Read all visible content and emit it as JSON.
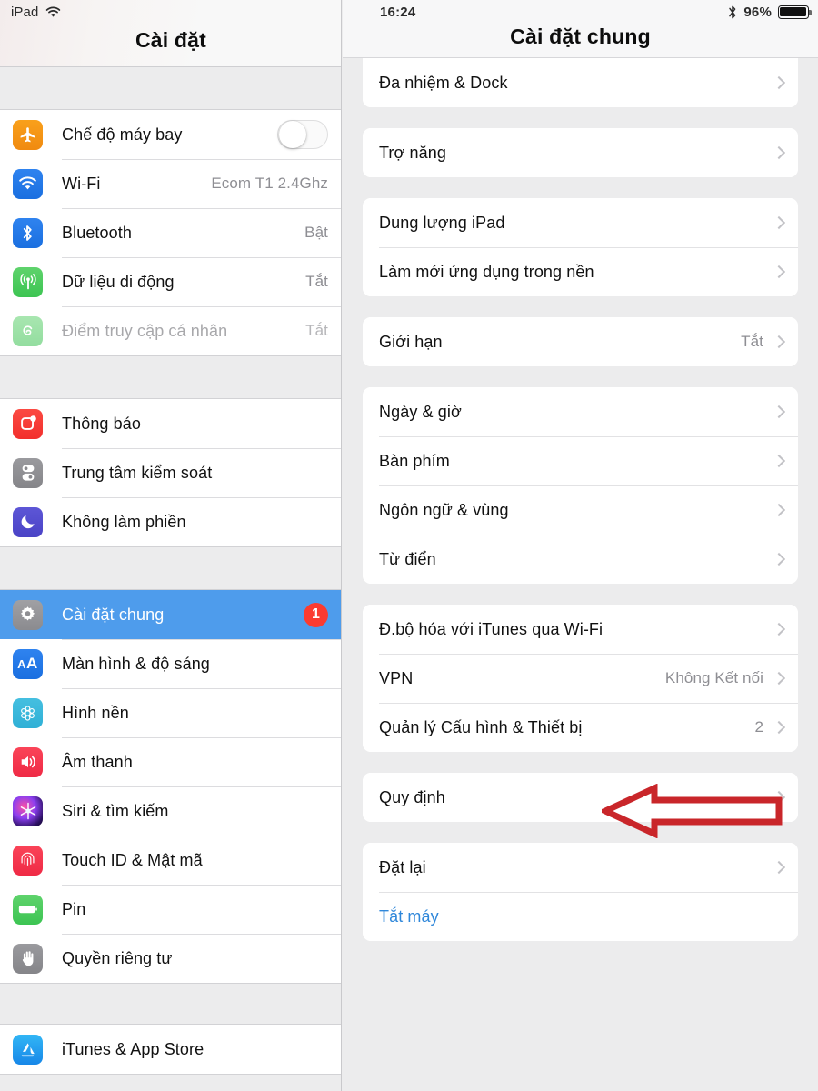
{
  "status_bar": {
    "device_label": "iPad",
    "wifi_icon": "wifi-icon",
    "time": "16:24",
    "bluetooth_icon": "bluetooth-icon",
    "battery_percent": "96%",
    "battery_level": 96
  },
  "sidebar": {
    "title": "Cài đặt",
    "groups": [
      {
        "rows": [
          {
            "icon": "airplane-icon",
            "label": "Chế độ máy bay",
            "control": "toggle",
            "toggle_on": false
          },
          {
            "icon": "wifi-icon",
            "label": "Wi-Fi",
            "value": "Ecom T1 2.4Ghz"
          },
          {
            "icon": "bluetooth-icon",
            "label": "Bluetooth",
            "value": "Bật"
          },
          {
            "icon": "cellular-icon",
            "label": "Dữ liệu di động",
            "value": "Tắt"
          },
          {
            "icon": "hotspot-icon",
            "label": "Điểm truy cập cá nhân",
            "value": "Tắt",
            "disabled": true
          }
        ]
      },
      {
        "rows": [
          {
            "icon": "notifications-icon",
            "label": "Thông báo"
          },
          {
            "icon": "control-center-icon",
            "label": "Trung tâm kiểm soát"
          },
          {
            "icon": "do-not-disturb-icon",
            "label": "Không làm phiền"
          }
        ]
      },
      {
        "rows": [
          {
            "icon": "gear-icon",
            "label": "Cài đặt chung",
            "badge": "1",
            "selected": true
          },
          {
            "icon": "display-brightness-icon",
            "label": "Màn hình & độ sáng"
          },
          {
            "icon": "wallpaper-icon",
            "label": "Hình nền"
          },
          {
            "icon": "sound-icon",
            "label": "Âm thanh"
          },
          {
            "icon": "siri-icon",
            "label": "Siri & tìm kiếm"
          },
          {
            "icon": "touch-id-icon",
            "label": "Touch ID & Mật mã"
          },
          {
            "icon": "battery-icon",
            "label": "Pin"
          },
          {
            "icon": "privacy-hand-icon",
            "label": "Quyền riêng tư"
          }
        ]
      },
      {
        "rows": [
          {
            "icon": "app-store-icon",
            "label": "iTunes & App Store"
          }
        ]
      }
    ]
  },
  "detail": {
    "title": "Cài đặt chung",
    "groups": [
      {
        "clipped_top": true,
        "rows": [
          {
            "label": "Đa nhiệm & Dock",
            "chevron": true
          }
        ]
      },
      {
        "rows": [
          {
            "label": "Trợ năng",
            "chevron": true
          }
        ]
      },
      {
        "rows": [
          {
            "label": "Dung lượng iPad",
            "chevron": true
          },
          {
            "label": "Làm mới ứng dụng trong nền",
            "chevron": true
          }
        ]
      },
      {
        "rows": [
          {
            "label": "Giới hạn",
            "value": "Tắt",
            "chevron": true
          }
        ]
      },
      {
        "rows": [
          {
            "label": "Ngày & giờ",
            "chevron": true
          },
          {
            "label": "Bàn phím",
            "chevron": true
          },
          {
            "label": "Ngôn ngữ & vùng",
            "chevron": true
          },
          {
            "label": "Từ điển",
            "chevron": true
          }
        ]
      },
      {
        "rows": [
          {
            "label": "Đ.bộ hóa với iTunes qua Wi-Fi",
            "chevron": true
          },
          {
            "label": "VPN",
            "value": "Không Kết nối",
            "chevron": true
          },
          {
            "label": "Quản lý Cấu hình & Thiết bị",
            "value": "2",
            "chevron": true,
            "annotated": true
          }
        ]
      },
      {
        "rows": [
          {
            "label": "Quy định",
            "chevron": true
          }
        ]
      },
      {
        "rows": [
          {
            "label": "Đặt lại",
            "chevron": true
          },
          {
            "label": "Tắt máy",
            "link": true
          }
        ]
      }
    ]
  },
  "annotation": {
    "type": "left-arrow",
    "color": "#c9262a",
    "points_to": "Quản lý Cấu hình & Thiết bị"
  },
  "colors": {
    "selection_blue": "#4e9cec",
    "badge_red": "#fb3b30",
    "link_blue": "#2f87da",
    "page_background": "#ececed",
    "card_background": "#ffffff",
    "secondary_text": "#8e8e93"
  }
}
